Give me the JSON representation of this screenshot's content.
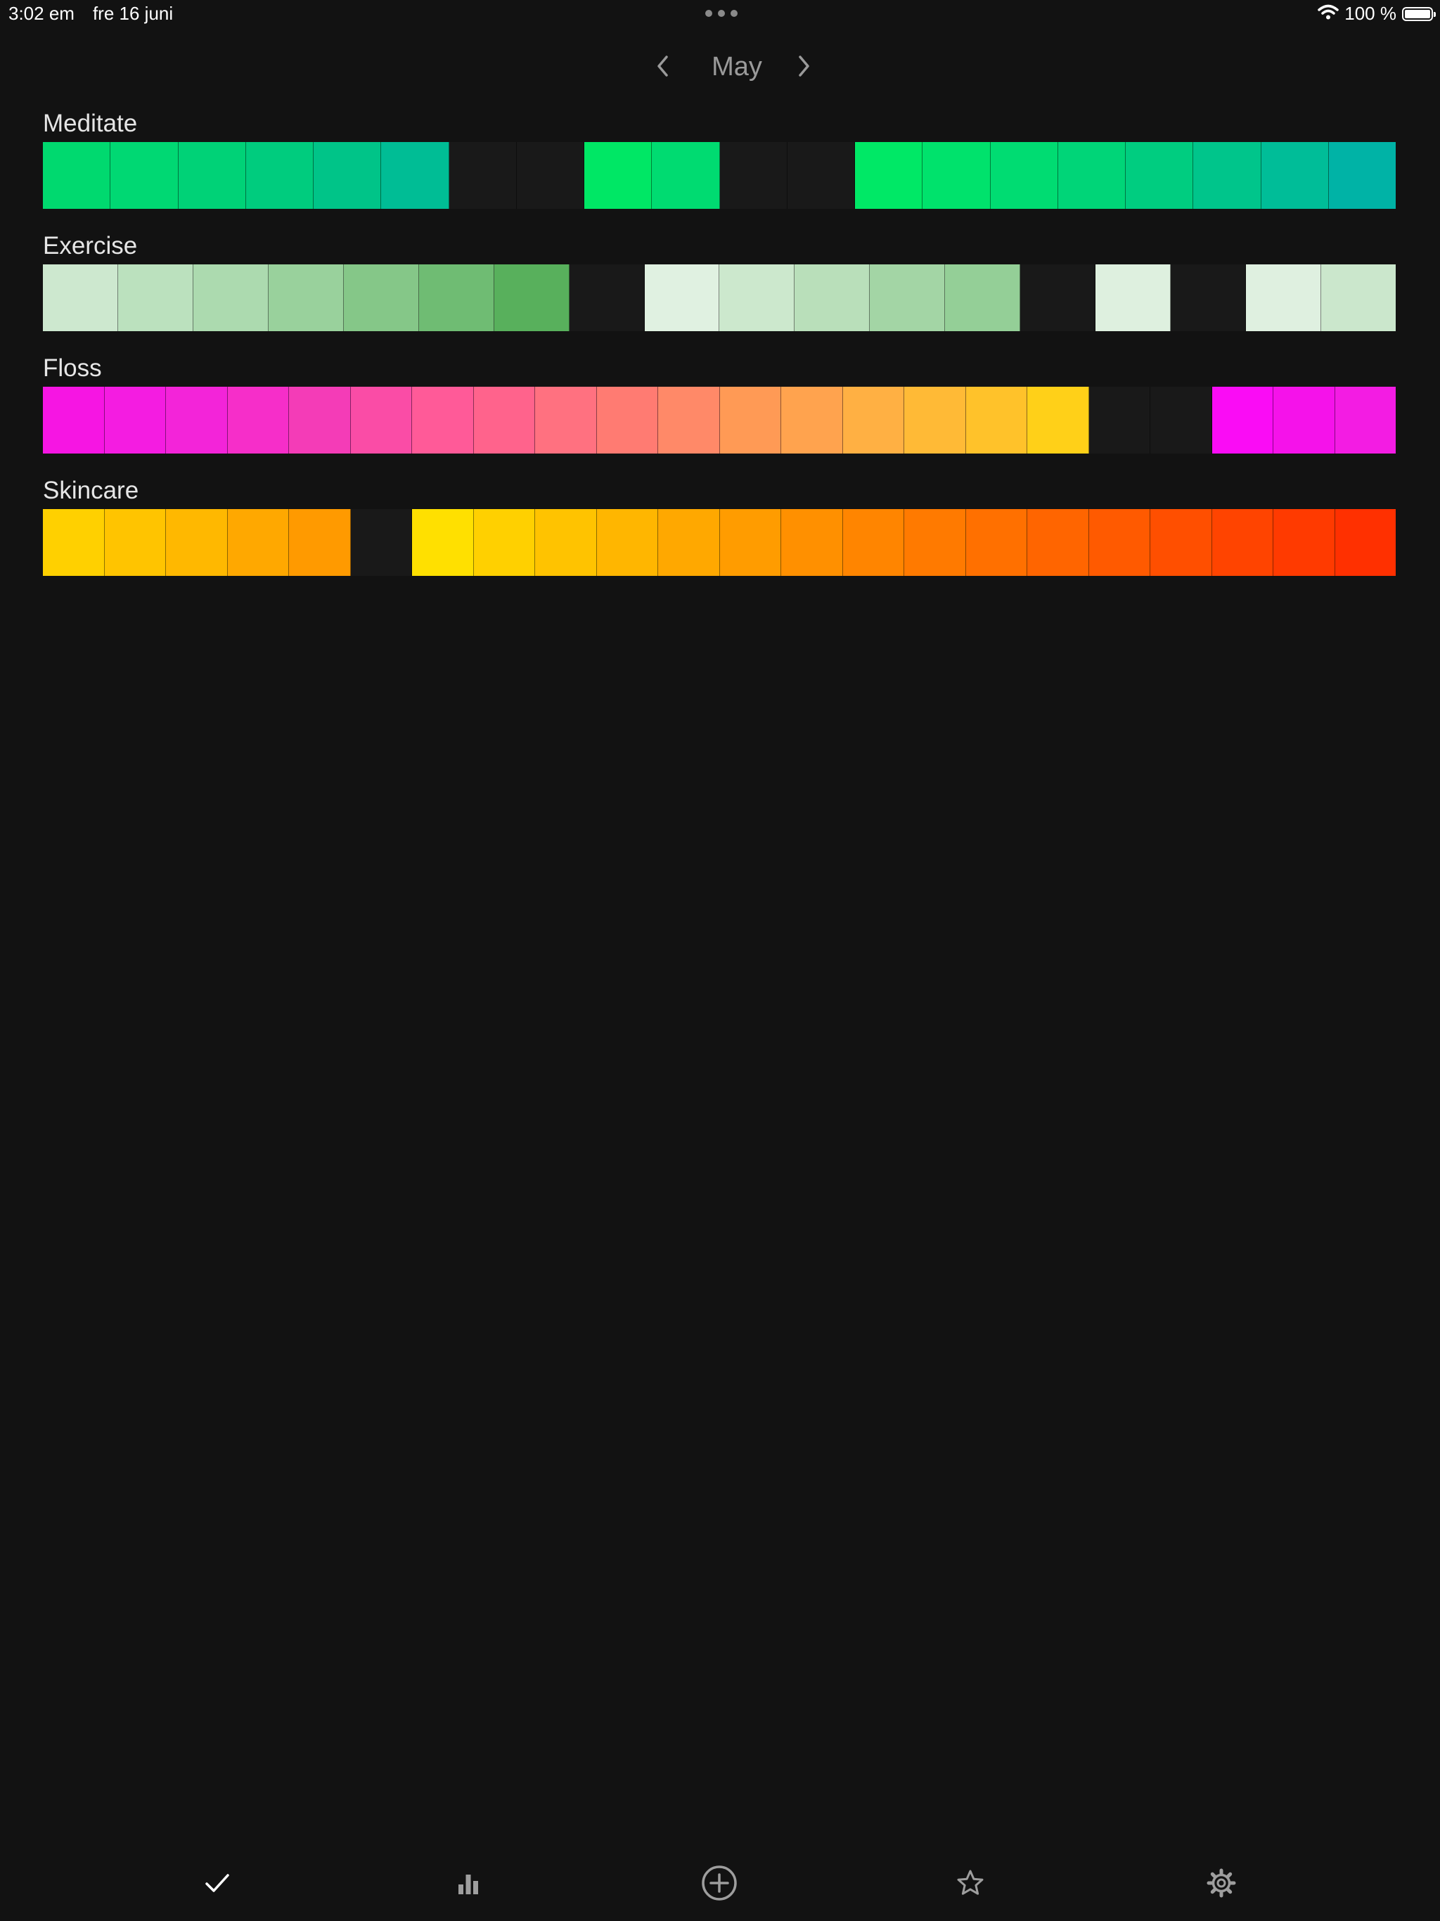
{
  "status_bar": {
    "time": "3:02 em",
    "date": "fre 16 juni",
    "battery": "100 %",
    "icons": [
      "more-dots-icon",
      "wifi-icon",
      "battery-icon"
    ]
  },
  "month_nav": {
    "title": "May",
    "prev_icon": "chevron-left-icon",
    "next_icon": "chevron-right-icon"
  },
  "empty_color": "#191919",
  "habits": [
    {
      "name": "Meditate",
      "cells": [
        "#00d96f",
        "#00d873",
        "#00d277",
        "#00cc7e",
        "#00c488",
        "#00bd95",
        null,
        null,
        "#00e765",
        "#00db71",
        null,
        null,
        "#00e866",
        "#00e26c",
        "#00dc72",
        "#00d578",
        "#00cd80",
        "#00c58b",
        "#00bd98",
        "#00b3a6"
      ]
    },
    {
      "name": "Exercise",
      "cells": [
        "#cde8cf",
        "#bbe1be",
        "#acdaaf",
        "#99d19c",
        "#85c788",
        "#6fbc73",
        "#58b05c",
        null,
        "#e0f1e1",
        "#cce8cd",
        "#b9dfba",
        "#a3d5a5",
        "#94cf97",
        null,
        "#def0df",
        null,
        "#dff0e0",
        "#cbe7cc"
      ]
    },
    {
      "name": "Floss",
      "cells": [
        "#f615e3",
        "#f41ce1",
        "#f324d9",
        "#f62ec9",
        "#f43cb7",
        "#fa4ca6",
        "#ff5a98",
        "#ff638c",
        "#ff7180",
        "#ff7b72",
        "#ff8968",
        "#ff9a55",
        "#ffa34e",
        "#ffb043",
        "#ffba36",
        "#ffc22a",
        "#ffd018",
        null,
        null,
        "#fa0cf5",
        "#f512ea",
        "#f31ce3"
      ]
    },
    {
      "name": "Skincare",
      "cells": [
        "#ffd000",
        "#ffc400",
        "#ffb800",
        "#ffa800",
        "#ff9a00",
        null,
        "#ffe000",
        "#ffd000",
        "#ffc300",
        "#ffb600",
        "#ffa800",
        "#ff9c00",
        "#ff9000",
        "#ff8500",
        "#ff7a00",
        "#ff7000",
        "#ff6500",
        "#ff5a00",
        "#ff4f00",
        "#ff4400",
        "#ff3a00",
        "#ff3000"
      ]
    }
  ],
  "tab_bar": {
    "tabs": [
      {
        "icon": "checkmark-icon",
        "active": true
      },
      {
        "icon": "bar-chart-icon",
        "active": false
      },
      {
        "icon": "add-circle-icon",
        "active": false
      },
      {
        "icon": "star-icon",
        "active": false
      },
      {
        "icon": "gear-icon",
        "active": false
      }
    ],
    "active_color": "#ffffff",
    "inactive_color": "#9e9e9e"
  }
}
